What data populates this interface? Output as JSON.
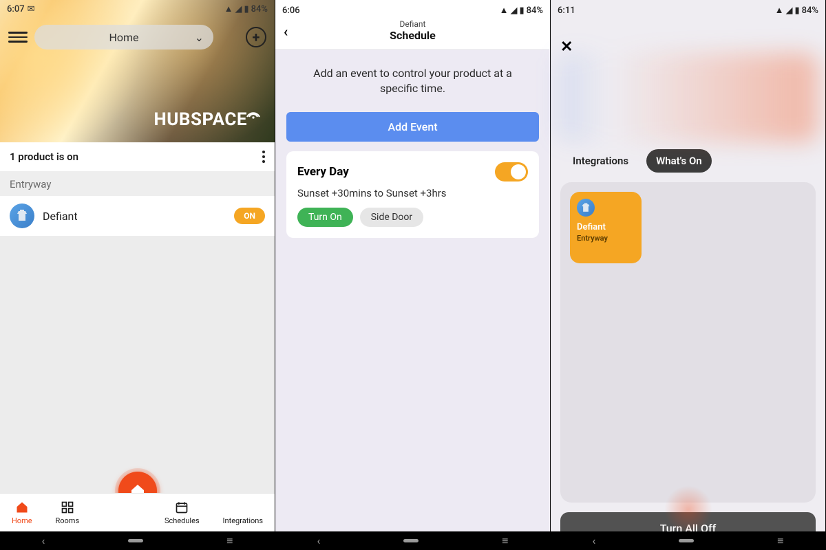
{
  "status": {
    "battery_pct": "84%",
    "times": [
      "6:07",
      "6:06",
      "6:11"
    ]
  },
  "screen1": {
    "location_selector": "Home",
    "brand": "HUBSPACE",
    "status_line": "1 product is on",
    "section_label": "Entryway",
    "device": {
      "name": "Defiant",
      "state": "ON"
    },
    "tabs": {
      "home": "Home",
      "rooms": "Rooms",
      "schedules": "Schedules",
      "integrations": "Integrations"
    }
  },
  "screen2": {
    "header_sub": "Defiant",
    "header_title": "Schedule",
    "info_text": "Add an event to control your product at a specific time.",
    "add_button": "Add Event",
    "event": {
      "title": "Every Day",
      "time_desc": "Sunset +30mins to Sunset +3hrs",
      "action_label": "Turn On",
      "location_label": "Side Door",
      "enabled": true
    }
  },
  "screen3": {
    "tabs": {
      "integrations": "Integrations",
      "whats_on": "What's On"
    },
    "tile": {
      "name": "Defiant",
      "room": "Entryway"
    },
    "turn_all_off": "Turn All Off"
  }
}
